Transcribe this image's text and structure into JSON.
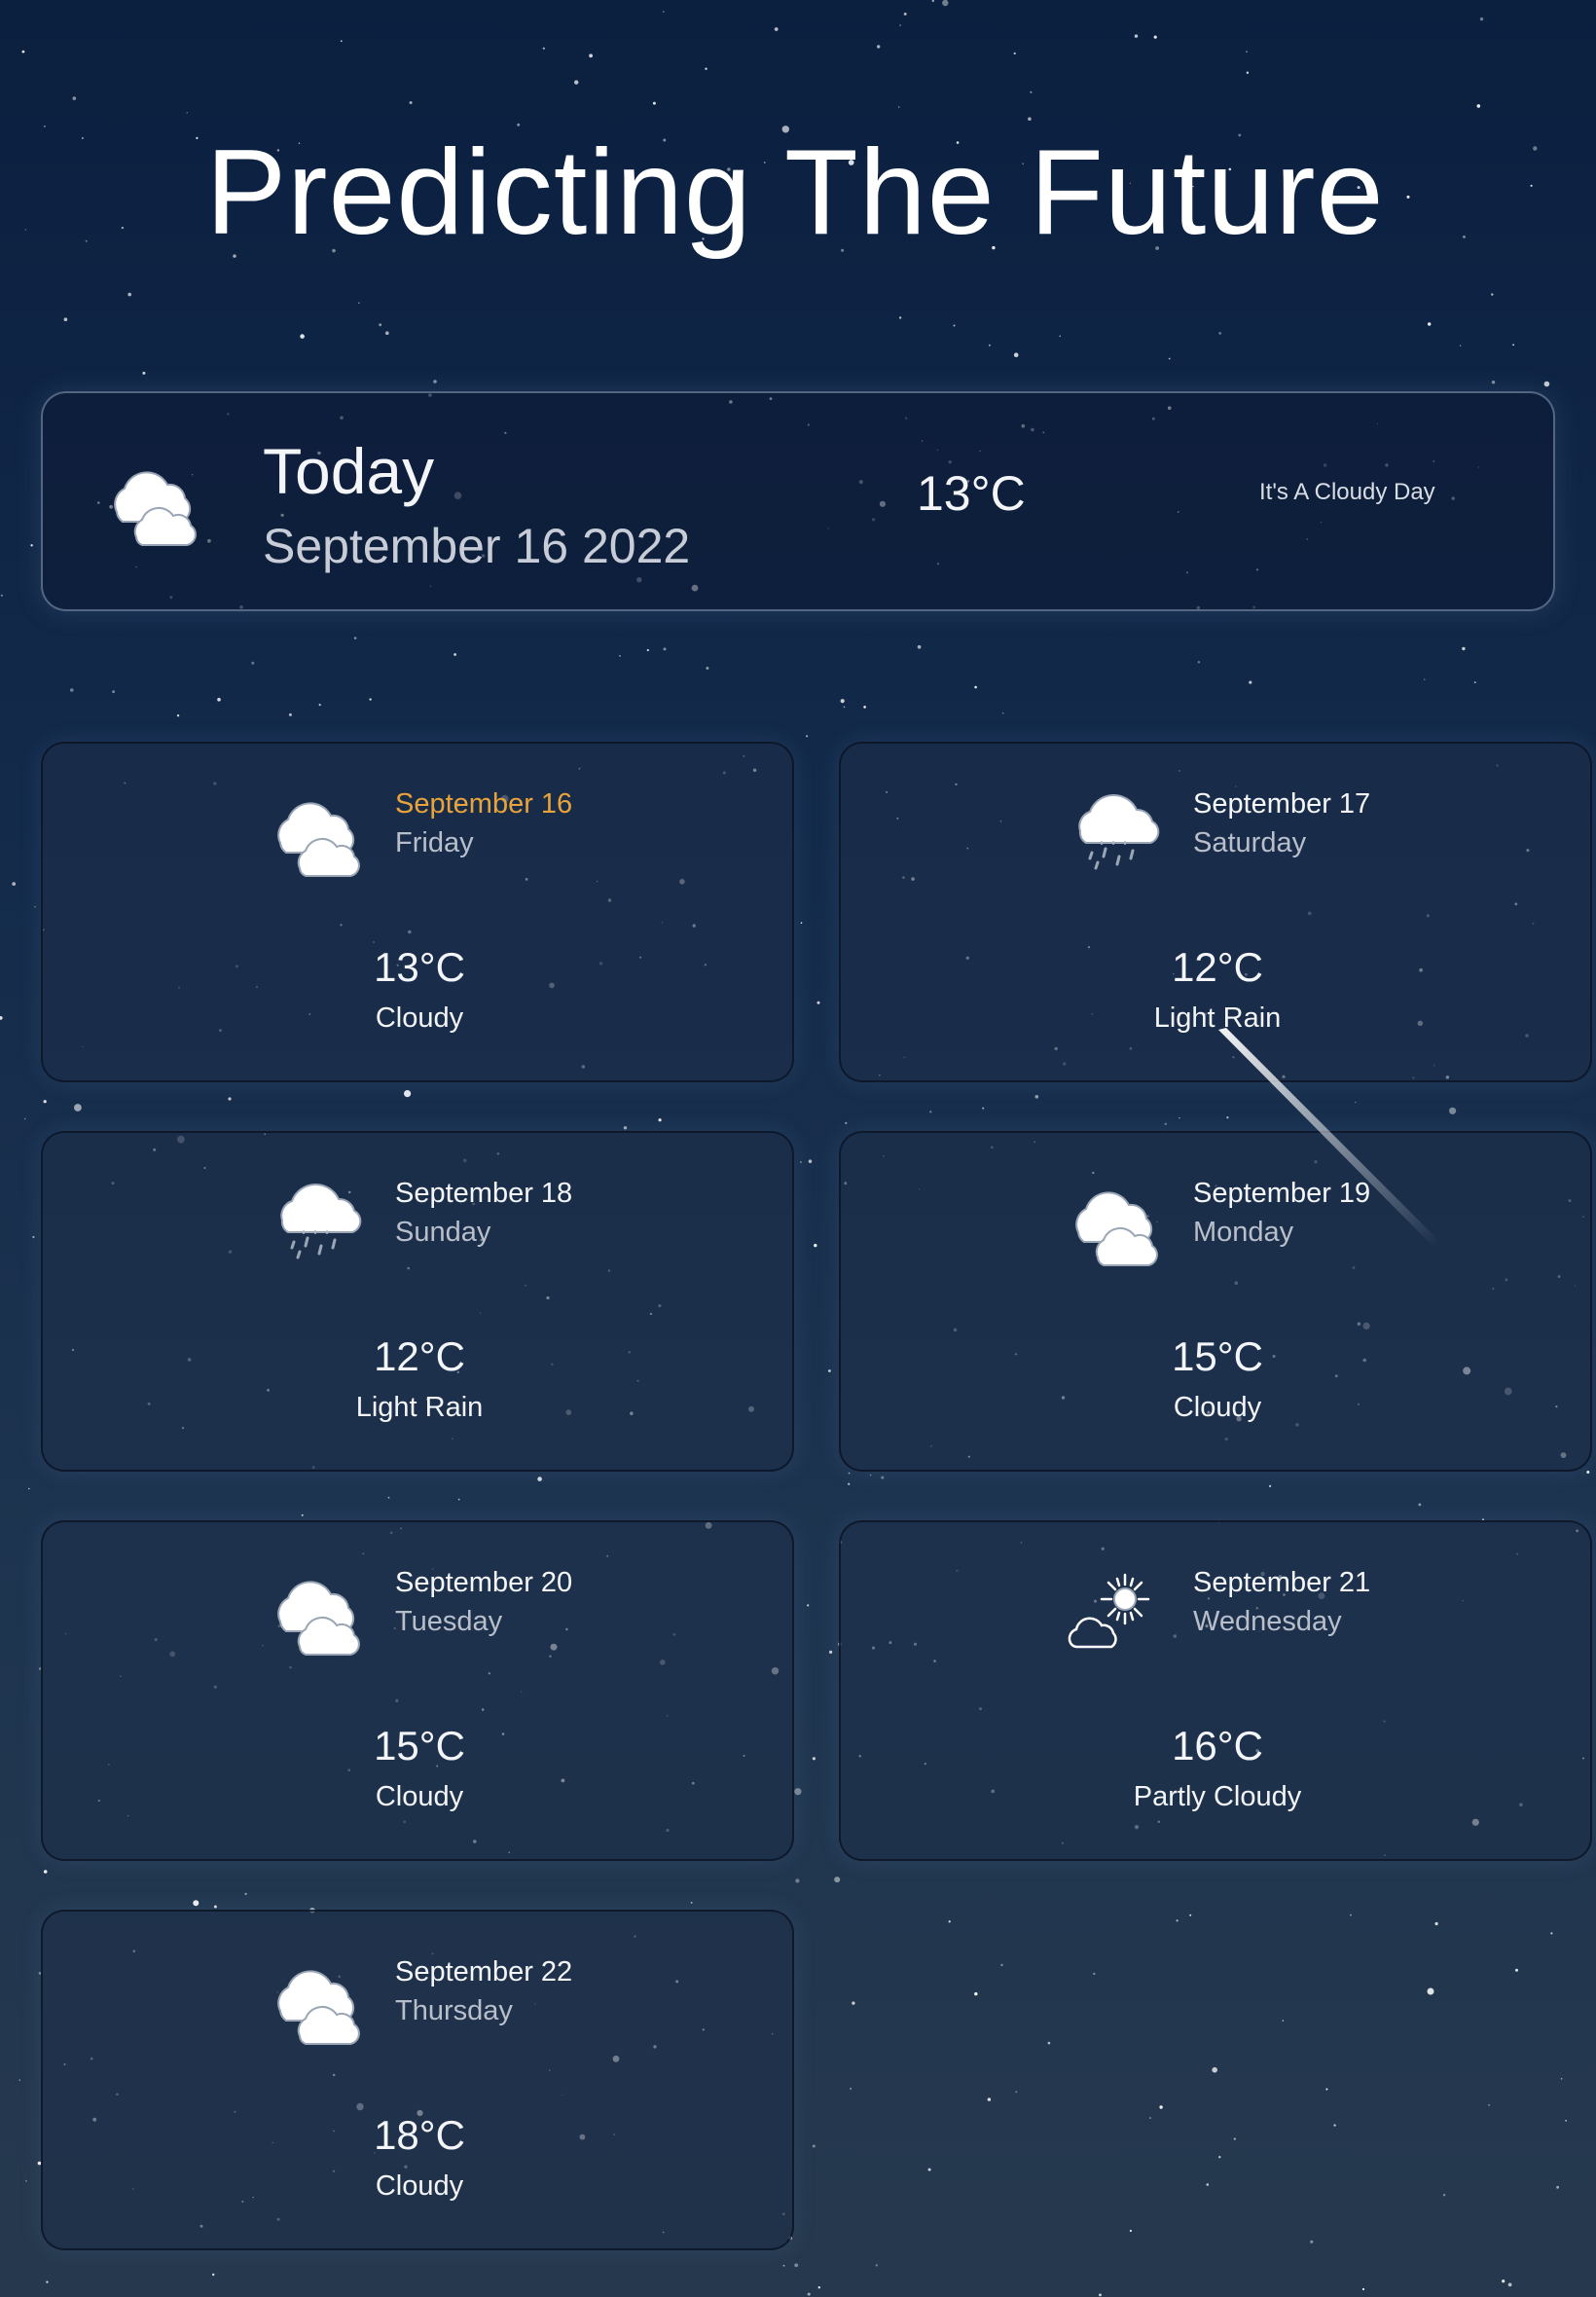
{
  "page": {
    "title": "Predicting The Future"
  },
  "today": {
    "label": "Today",
    "date": "September 16 2022",
    "temperature": "13°C",
    "description": "It's A Cloudy Day",
    "icon": "cloudy-icon"
  },
  "forecast": [
    {
      "date": "September 16",
      "weekday": "Friday",
      "temperature": "13°C",
      "condition": "Cloudy",
      "icon": "cloudy-icon",
      "highlight_color": "#e8a33a"
    },
    {
      "date": "September 17",
      "weekday": "Saturday",
      "temperature": "12°C",
      "condition": "Light Rain",
      "icon": "light-rain-icon"
    },
    {
      "date": "September 18",
      "weekday": "Sunday",
      "temperature": "12°C",
      "condition": "Light Rain",
      "icon": "light-rain-icon"
    },
    {
      "date": "September 19",
      "weekday": "Monday",
      "temperature": "15°C",
      "condition": "Cloudy",
      "icon": "cloudy-icon"
    },
    {
      "date": "September 20",
      "weekday": "Tuesday",
      "temperature": "15°C",
      "condition": "Cloudy",
      "icon": "cloudy-icon"
    },
    {
      "date": "September 21",
      "weekday": "Wednesday",
      "temperature": "16°C",
      "condition": "Partly Cloudy",
      "icon": "partly-cloudy-icon"
    },
    {
      "date": "September 22",
      "weekday": "Thursday",
      "temperature": "18°C",
      "condition": "Cloudy",
      "icon": "cloudy-icon"
    }
  ],
  "colors": {
    "background_top": "#0b1f3f",
    "background_bottom": "#26384d",
    "text": "#ffffff",
    "secondary_text": "#b9bfca",
    "highlight": "#e8a33a"
  }
}
